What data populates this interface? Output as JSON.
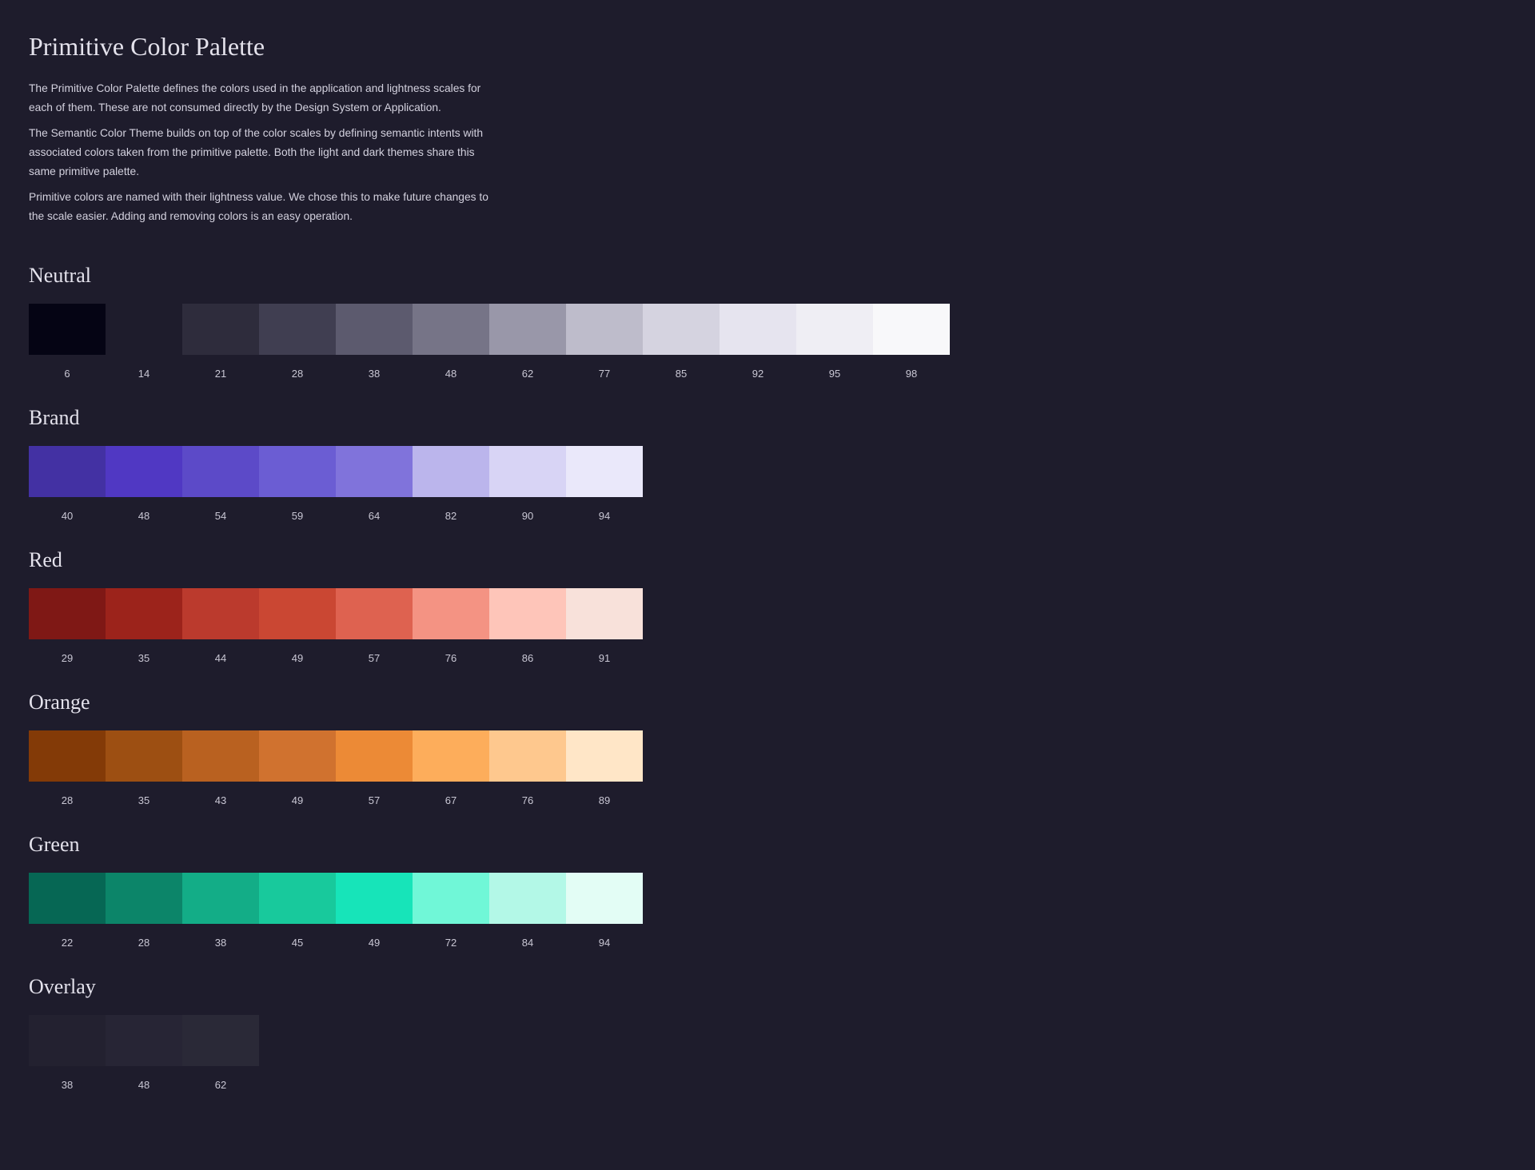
{
  "page": {
    "title": "Primitive Color Palette",
    "paragraphs": [
      "The Primitive Color Palette defines the colors used in the application and lightness scales for each of them. These are not consumed directly by the Design System or Application.",
      "The Semantic Color Theme builds on top of the color scales by defining semantic intents with associated colors taken from the primitive palette. Both the light and dark themes share this same primitive palette.",
      "Primitive colors are named with their lightness value. We chose this to make future changes to the scale easier. Adding and removing colors is an easy operation."
    ]
  },
  "palettes": [
    {
      "name": "Neutral",
      "swatches": [
        {
          "label": "6",
          "color": "#050414"
        },
        {
          "label": "14",
          "color": "#1e1c2c"
        },
        {
          "label": "21",
          "color": "#2e2c3c"
        },
        {
          "label": "28",
          "color": "#403e51"
        },
        {
          "label": "38",
          "color": "#5c5a6e"
        },
        {
          "label": "48",
          "color": "#767487"
        },
        {
          "label": "62",
          "color": "#9997a9"
        },
        {
          "label": "77",
          "color": "#bebccb"
        },
        {
          "label": "85",
          "color": "#d5d3e0"
        },
        {
          "label": "92",
          "color": "#e6e4ef"
        },
        {
          "label": "95",
          "color": "#efeef4"
        },
        {
          "label": "98",
          "color": "#f8f8fa"
        }
      ]
    },
    {
      "name": "Brand",
      "swatches": [
        {
          "label": "40",
          "color": "#4331a3"
        },
        {
          "label": "48",
          "color": "#5038c3"
        },
        {
          "label": "54",
          "color": "#5c4ac8"
        },
        {
          "label": "59",
          "color": "#6b5dd3"
        },
        {
          "label": "64",
          "color": "#8073db"
        },
        {
          "label": "82",
          "color": "#bbb5ec"
        },
        {
          "label": "90",
          "color": "#d8d4f5"
        },
        {
          "label": "94",
          "color": "#eae8fa"
        }
      ]
    },
    {
      "name": "Red",
      "swatches": [
        {
          "label": "29",
          "color": "#7f1815"
        },
        {
          "label": "35",
          "color": "#9c231b"
        },
        {
          "label": "44",
          "color": "#bb3a2d"
        },
        {
          "label": "49",
          "color": "#ca4733"
        },
        {
          "label": "57",
          "color": "#de6250"
        },
        {
          "label": "76",
          "color": "#f49383"
        },
        {
          "label": "86",
          "color": "#fec5b9"
        },
        {
          "label": "91",
          "color": "#f8e1da"
        }
      ]
    },
    {
      "name": "Orange",
      "swatches": [
        {
          "label": "28",
          "color": "#833a07"
        },
        {
          "label": "35",
          "color": "#9d4f12"
        },
        {
          "label": "43",
          "color": "#b96120"
        },
        {
          "label": "49",
          "color": "#d0722f"
        },
        {
          "label": "57",
          "color": "#ec8a36"
        },
        {
          "label": "67",
          "color": "#fdad5b"
        },
        {
          "label": "76",
          "color": "#fec88e"
        },
        {
          "label": "89",
          "color": "#ffe6c7"
        }
      ]
    },
    {
      "name": "Green",
      "swatches": [
        {
          "label": "22",
          "color": "#066754"
        },
        {
          "label": "28",
          "color": "#0c8569"
        },
        {
          "label": "38",
          "color": "#13ad87"
        },
        {
          "label": "45",
          "color": "#18c99c"
        },
        {
          "label": "49",
          "color": "#17e4b9"
        },
        {
          "label": "72",
          "color": "#70f7d7"
        },
        {
          "label": "84",
          "color": "#b3f8e7"
        },
        {
          "label": "94",
          "color": "#e3fdf5"
        }
      ]
    },
    {
      "name": "Overlay",
      "swatches": [
        {
          "label": "38",
          "color": "#232130"
        },
        {
          "label": "48",
          "color": "#272535"
        },
        {
          "label": "62",
          "color": "#2a2937"
        }
      ]
    }
  ]
}
